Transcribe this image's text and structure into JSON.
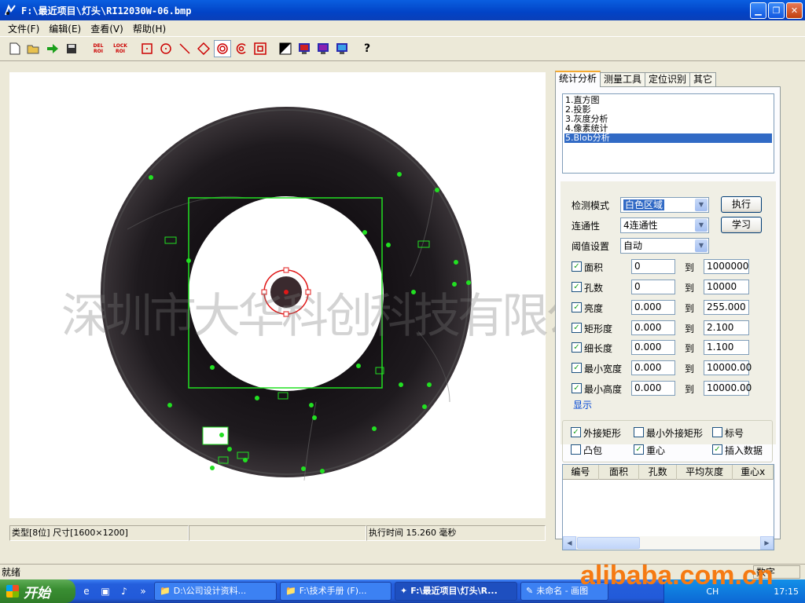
{
  "window": {
    "title": "F:\\最近项目\\灯头\\RI12030W-06.bmp"
  },
  "menu": [
    "文件(F)",
    "编辑(E)",
    "查看(V)",
    "帮助(H)"
  ],
  "toolbar": {
    "del_roi": [
      "DEL",
      "ROI"
    ],
    "lock_roi": [
      "LOCK",
      "ROI"
    ]
  },
  "status": {
    "info": "类型[8位] 尺寸[1600×1200]",
    "exec": "执行时间 15.260 毫秒",
    "app": "就绪",
    "mode": "数字"
  },
  "tabs": [
    "统计分析",
    "测量工具",
    "定位识别",
    "其它"
  ],
  "analysis_list": [
    "1.直方图",
    "2.投影",
    "3.灰度分析",
    "4.像素统计",
    "5.Blob分析"
  ],
  "params": {
    "detect_mode_label": "检测模式",
    "detect_mode_value": "白色区域",
    "connectivity_label": "连通性",
    "connectivity_value": "4连通性",
    "threshold_label": "阈值设置",
    "threshold_value": "自动",
    "execute_btn": "执行",
    "learn_btn": "学习",
    "to": "到"
  },
  "filters": [
    {
      "label": "面积",
      "min": "0",
      "max": "1000000"
    },
    {
      "label": "孔数",
      "min": "0",
      "max": "10000"
    },
    {
      "label": "亮度",
      "min": "0.000",
      "max": "255.000"
    },
    {
      "label": "矩形度",
      "min": "0.000",
      "max": "2.100"
    },
    {
      "label": "细长度",
      "min": "0.000",
      "max": "1.100"
    },
    {
      "label": "最小宽度",
      "min": "0.000",
      "max": "10000.00"
    },
    {
      "label": "最小高度",
      "min": "0.000",
      "max": "10000.00"
    }
  ],
  "display": {
    "group_title": "显示",
    "options": [
      {
        "label": "外接矩形",
        "checked": true
      },
      {
        "label": "最小外接矩形",
        "checked": false
      },
      {
        "label": "标号",
        "checked": false
      },
      {
        "label": "凸包",
        "checked": false
      },
      {
        "label": "重心",
        "checked": true
      },
      {
        "label": "插入数据",
        "checked": true
      }
    ]
  },
  "result_table": {
    "columns": [
      "编号",
      "面积",
      "孔数",
      "平均灰度",
      "重心x"
    ]
  },
  "taskbar": {
    "start": "开始",
    "tasks": [
      "D:\\公司设计资料...",
      "F:\\技术手册 (F)...",
      "F:\\最近项目\\灯头\\R...",
      "未命名 - 画图"
    ],
    "lang": "CH",
    "clock": "17:15"
  },
  "watermarks": {
    "center": "深圳市大华科创科技有限公司",
    "corner": "alibaba.com.cn"
  },
  "colors": {
    "titlebar": "#0A5FE0",
    "overlay_green": "#22E022",
    "overlay_red": "#E01818",
    "selection": "#316AC5"
  }
}
